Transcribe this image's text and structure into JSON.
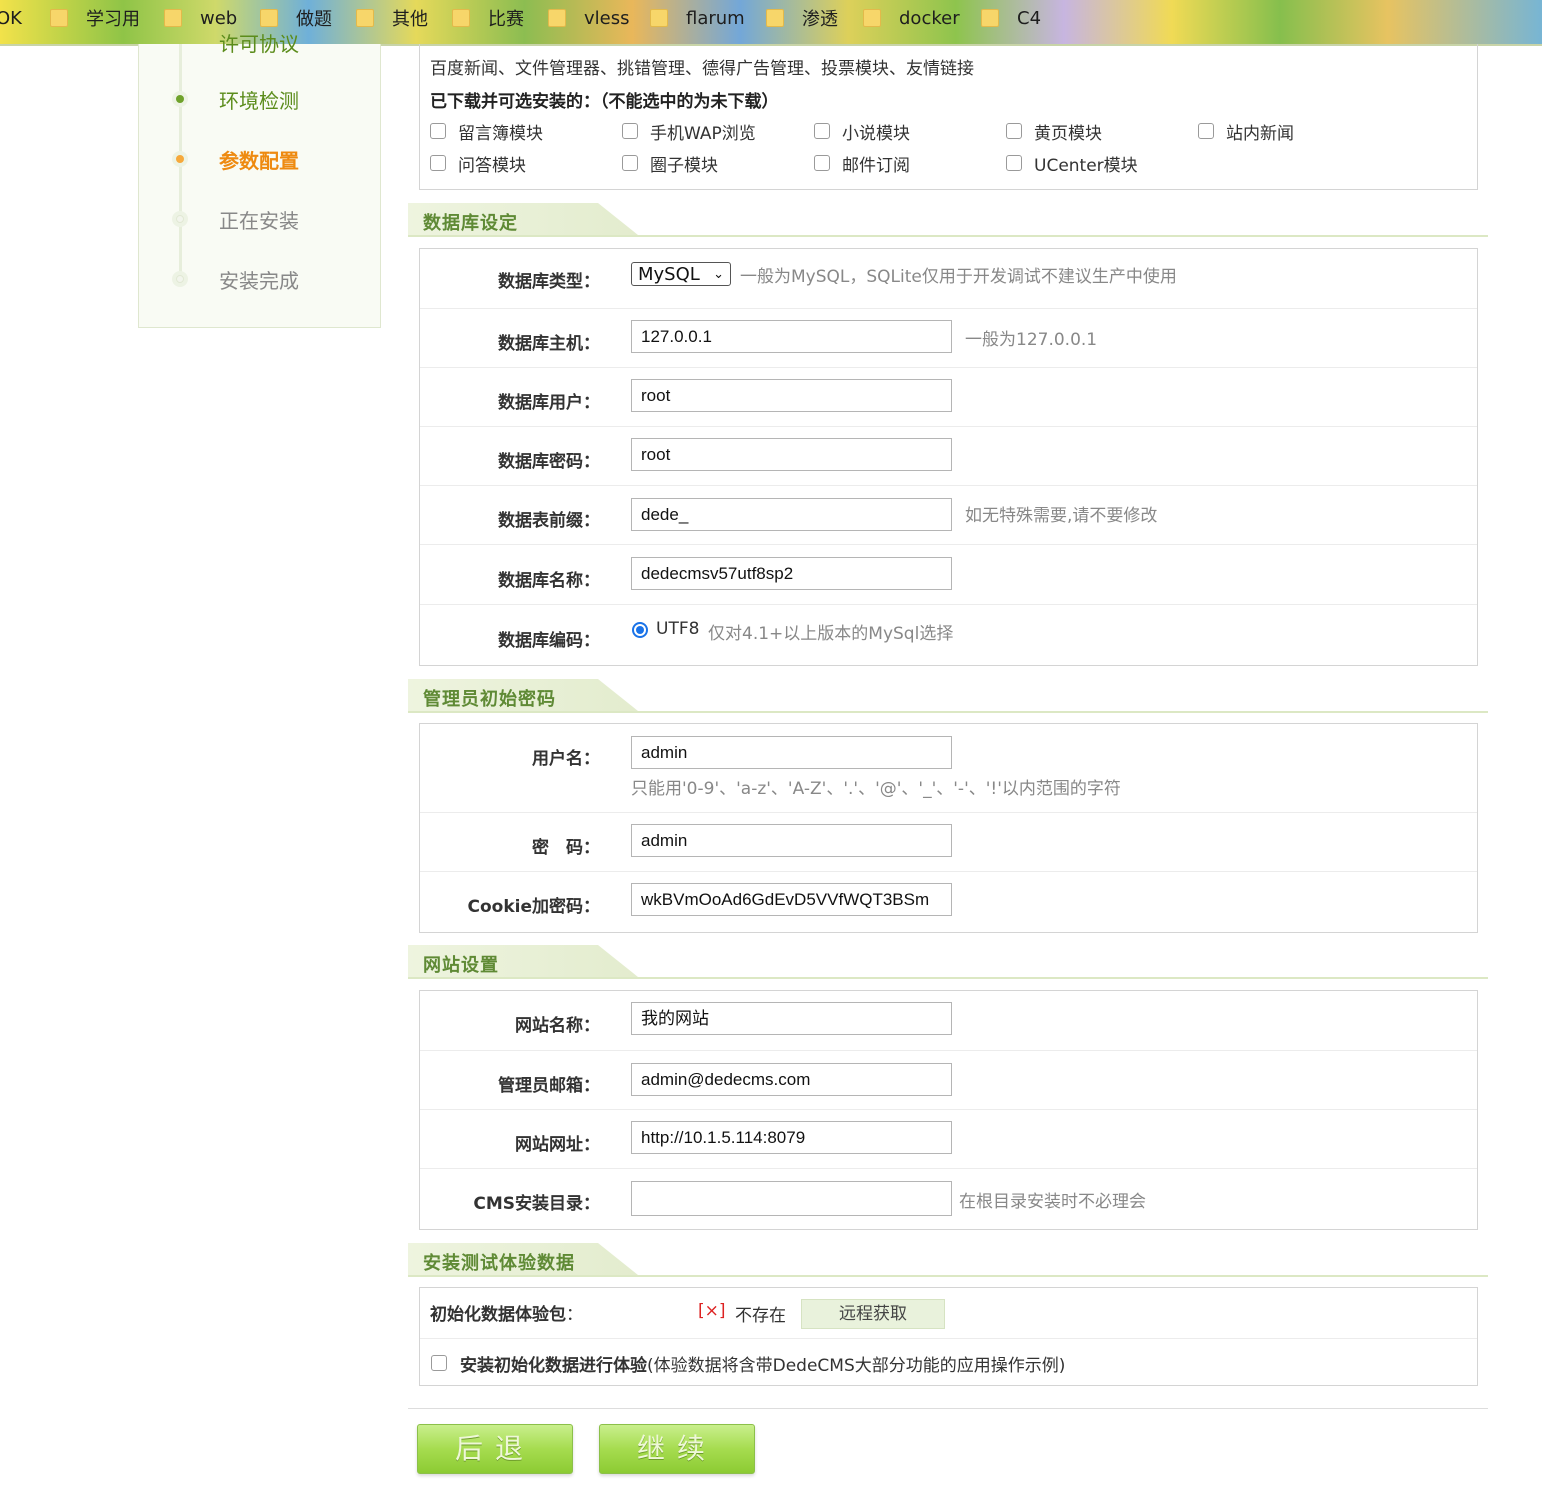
{
  "bookmarks": [
    "OK",
    "学习用",
    "web",
    "做题",
    "其他",
    "比赛",
    "vless",
    "flarum",
    "渗透",
    "docker",
    "C4"
  ],
  "sidebar": {
    "partial_top_label": "许可协议",
    "steps": [
      {
        "label": "环境检测",
        "state": "done"
      },
      {
        "label": "参数配置",
        "state": "current"
      },
      {
        "label": "正在安装",
        "state": "todo"
      },
      {
        "label": "安装完成",
        "state": "todo"
      }
    ]
  },
  "modules": {
    "installed_line": "百度新闻、文件管理器、挑错管理、德得广告管理、投票模块、友情链接",
    "title": "已下载并可选安装的：（不能选中的为未下载）",
    "items": [
      "留言簿模块",
      "手机WAP浏览",
      "小说模块",
      "黄页模块",
      "站内新闻",
      "问答模块",
      "圈子模块",
      "邮件订阅",
      "UCenter模块"
    ]
  },
  "db": {
    "section_title": "数据库设定",
    "type_label": "数据库类型：",
    "type_value": "MySQL",
    "type_hint": "一般为MySQL，SQLite仅用于开发调试不建议生产中使用",
    "host_label": "数据库主机：",
    "host_value": "127.0.0.1",
    "host_hint": "一般为127.0.0.1",
    "user_label": "数据库用户：",
    "user_value": "root",
    "pass_label": "数据库密码：",
    "pass_value": "root",
    "prefix_label": "数据表前缀：",
    "prefix_value": "dede_",
    "prefix_hint": "如无特殊需要,请不要修改",
    "name_label": "数据库名称：",
    "name_value": "dedecmsv57utf8sp2",
    "charset_label": "数据库编码：",
    "charset_value": "UTF8",
    "charset_hint": "仅对4.1+以上版本的MySql选择"
  },
  "admin": {
    "section_title": "管理员初始密码",
    "user_label": "用户名：",
    "user_value": "admin",
    "user_hint": "只能用'0-9'、'a-z'、'A-Z'、'.'、'@'、'_'、'-'、'!'以内范围的字符",
    "pass_label": "密　码：",
    "pass_value": "admin",
    "cookie_label": "Cookie加密码：",
    "cookie_value": "wkBVmOoAd6GdEvD5VVfWQT3BSm"
  },
  "site": {
    "section_title": "网站设置",
    "name_label": "网站名称：",
    "name_value": "我的网站",
    "email_label": "管理员邮箱：",
    "email_value": "admin@dedecms.com",
    "url_label": "网站网址：",
    "url_value": "http://10.1.5.114:8079",
    "dir_label": "CMS安装目录：",
    "dir_value": "",
    "dir_hint": "在根目录安装时不必理会"
  },
  "demo": {
    "section_title": "安装测试体验数据",
    "pkg_label": "初始化数据体验包",
    "pkg_colon": "：",
    "status_mark": "[×]",
    "status_text": "不存在",
    "fetch_button": "远程获取",
    "install_label": "安装初始化数据进行体验",
    "install_note": "(体验数据将含带DedeCMS大部分功能的应用操作示例)"
  },
  "buttons": {
    "back": "后退",
    "continue": "继续"
  },
  "colors": {
    "accent_green": "#5f8a35",
    "current_step_orange": "#ee8a10",
    "error_red": "#d22",
    "radio_blue": "#1a73e8"
  }
}
